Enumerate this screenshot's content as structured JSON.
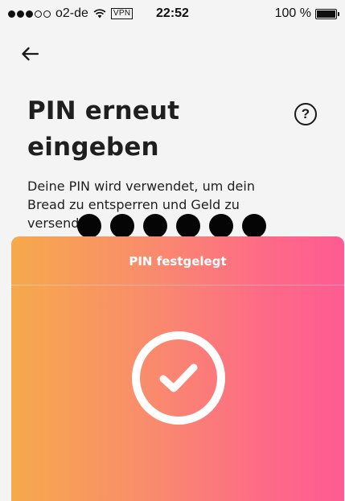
{
  "status_bar": {
    "signal_filled": 3,
    "signal_total": 5,
    "carrier": "o2-de",
    "vpn": "VPN",
    "time": "22:52",
    "battery_percent": "100 %",
    "icons": [
      "signal-dots-icon",
      "wifi-icon",
      "battery-icon"
    ]
  },
  "header": {
    "back_icon": "arrow-left-icon",
    "help_icon": "question-mark-icon",
    "help_label": "?"
  },
  "main": {
    "title_line1": "PIN erneut",
    "title_line2": "eingeben",
    "description_line1": "Deine PIN wird verwendet, um dein",
    "description_line2": "Bread zu entsperren und Geld zu",
    "description_line3": "versenden.",
    "pin_length": 6,
    "pin_filled": 6
  },
  "success_card": {
    "title": "PIN festgelegt",
    "icon": "checkmark-circle-icon",
    "gradient_start": "#f6a94c",
    "gradient_end": "#ff5b93"
  }
}
